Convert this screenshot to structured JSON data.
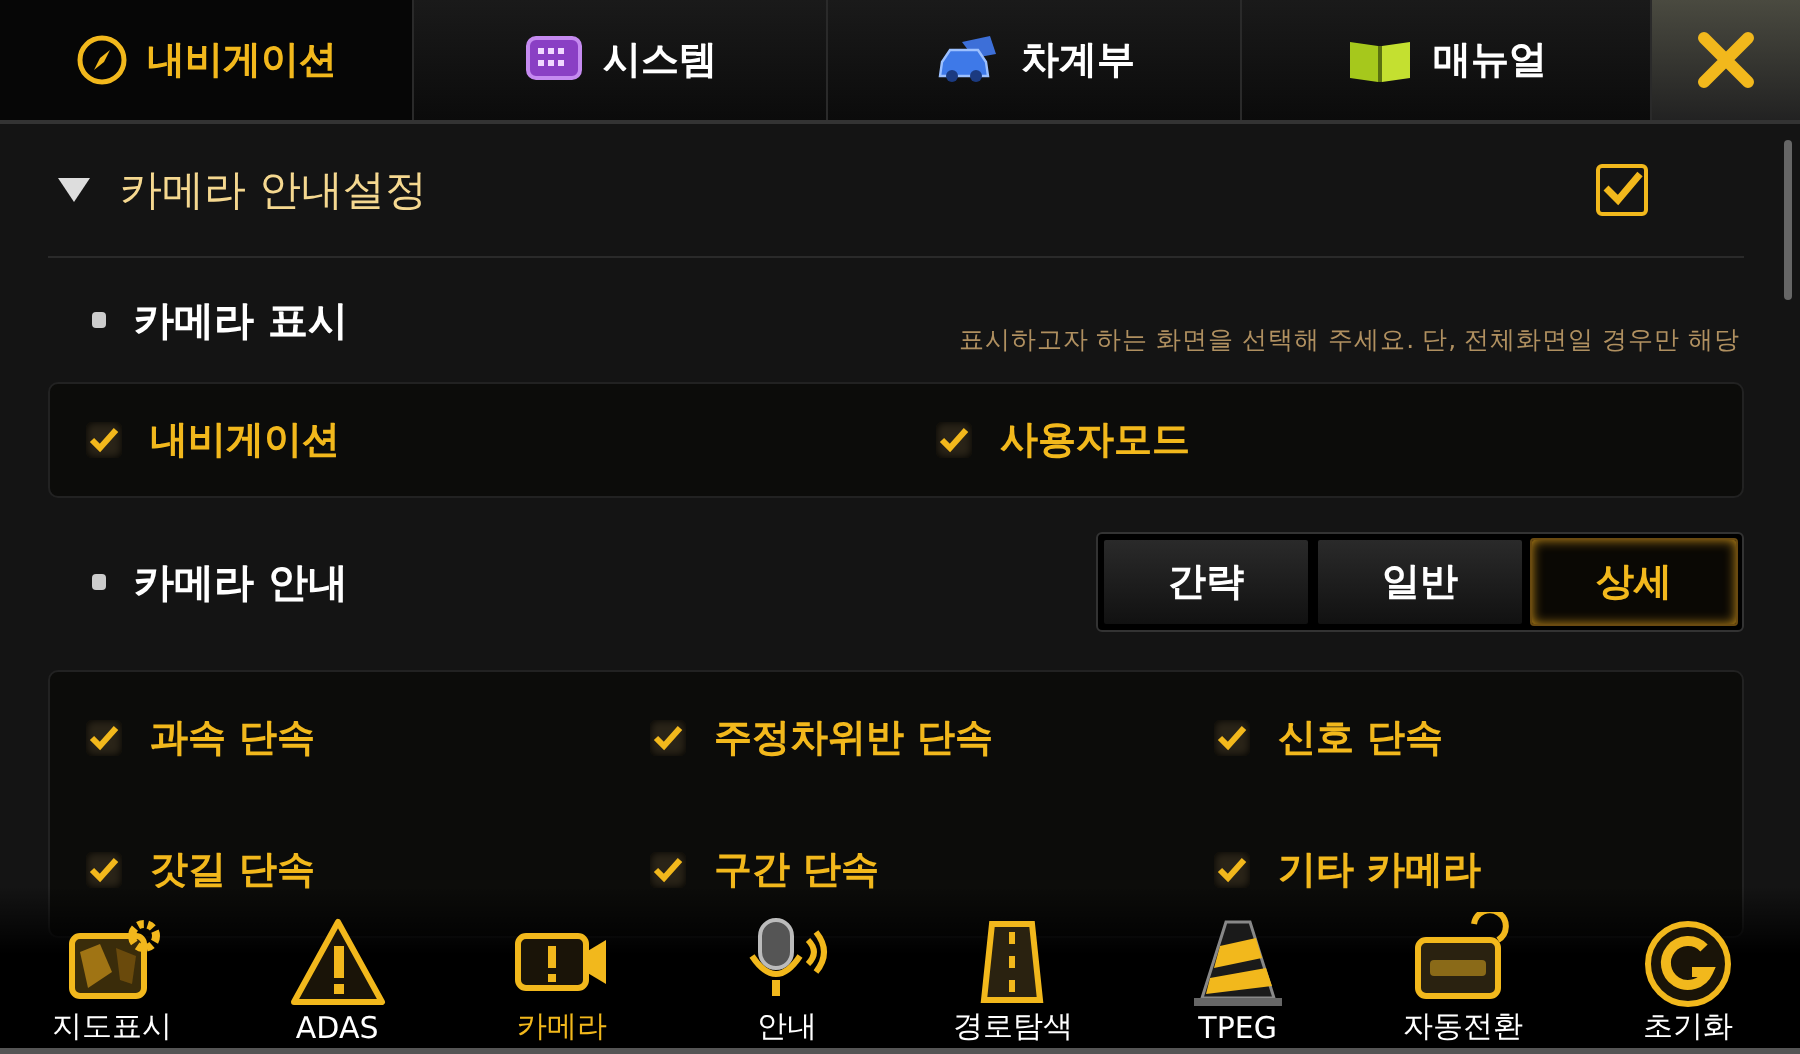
{
  "tabs": [
    {
      "label": "내비게이션",
      "selected": true
    },
    {
      "label": "시스템",
      "selected": false
    },
    {
      "label": "차계부",
      "selected": false
    },
    {
      "label": "매뉴얼",
      "selected": false
    }
  ],
  "section": {
    "title": "카메라 안내설정",
    "expanded": true,
    "checked": true
  },
  "display": {
    "title": "카메라 표시",
    "hint": "표시하고자 하는 화면을 선택해 주세요. 단, 전체화면일 경우만 해당",
    "options": [
      {
        "label": "내비게이션",
        "checked": true
      },
      {
        "label": "사용자모드",
        "checked": true
      }
    ]
  },
  "guide": {
    "title": "카메라 안내",
    "modes": [
      {
        "label": "간략",
        "selected": false
      },
      {
        "label": "일반",
        "selected": false
      },
      {
        "label": "상세",
        "selected": true
      }
    ],
    "options": [
      {
        "label": "과속 단속",
        "checked": true
      },
      {
        "label": "주정차위반 단속",
        "checked": true
      },
      {
        "label": "신호 단속",
        "checked": true
      },
      {
        "label": "갓길 단속",
        "checked": true
      },
      {
        "label": "구간 단속",
        "checked": true
      },
      {
        "label": "기타 카메라",
        "checked": true
      }
    ]
  },
  "dock": [
    {
      "label": "지도표시",
      "selected": false
    },
    {
      "label": "ADAS",
      "selected": false
    },
    {
      "label": "카메라",
      "selected": true
    },
    {
      "label": "안내",
      "selected": false
    },
    {
      "label": "경로탐색",
      "selected": false
    },
    {
      "label": "TPEG",
      "selected": false
    },
    {
      "label": "자동전환",
      "selected": false
    },
    {
      "label": "초기화",
      "selected": false
    }
  ]
}
